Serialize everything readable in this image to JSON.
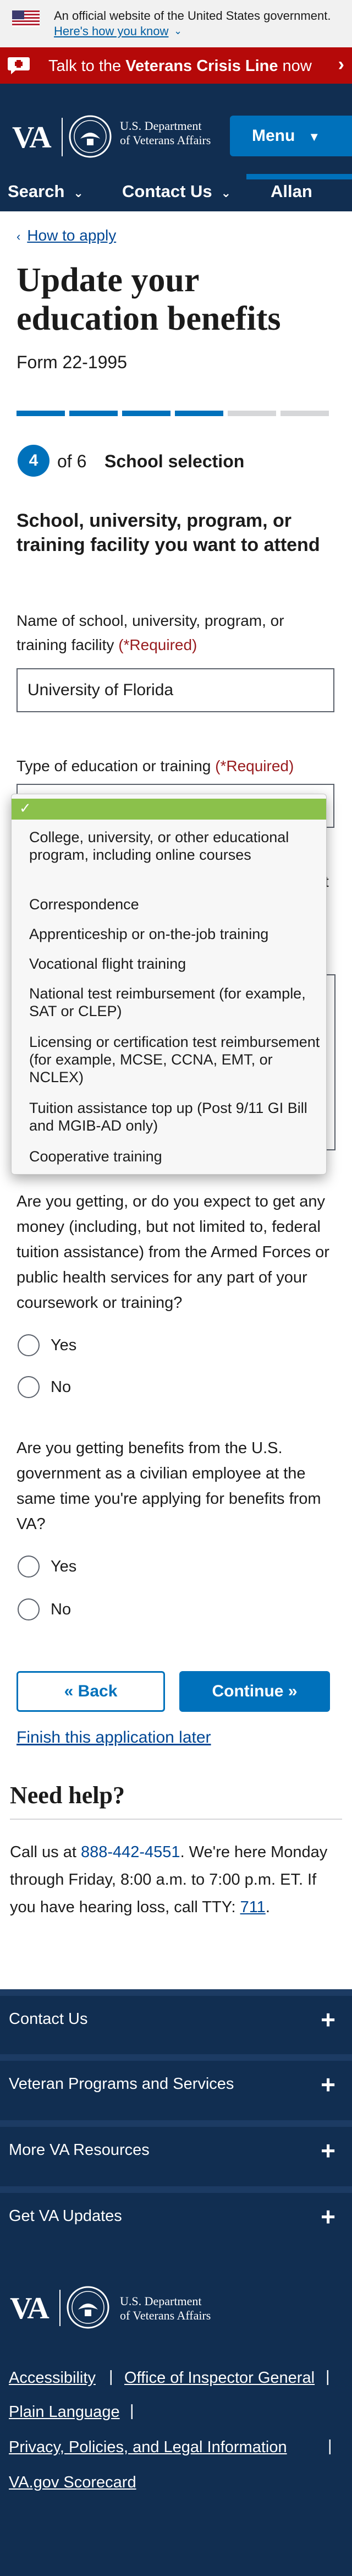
{
  "gov_banner": {
    "official_text": "An official website of the United States government.",
    "how_you_know": "Here's how you know"
  },
  "crisis_line": {
    "prefix": "Talk to the ",
    "strong": "Veterans Crisis Line",
    "suffix": " now"
  },
  "header": {
    "logo": "VA",
    "dept_line1": "U.S. Department",
    "dept_line2": "of Veterans Affairs",
    "menu_label": "Menu",
    "nav": [
      "Search",
      "Contact Us",
      "Allan"
    ]
  },
  "breadcrumb": {
    "label": "How to apply"
  },
  "page": {
    "title": "Update your education benefits",
    "form_number": "Form 22-1995"
  },
  "progress": {
    "current_step": "4",
    "total_label": "of 6",
    "step_name": "School selection",
    "completed_segments": 4,
    "total_segments": 6
  },
  "section": {
    "heading": "School, university, program, or training facility you want to attend"
  },
  "school_field": {
    "label": "Name of school, university, program, or training facility",
    "required": "(*Required)",
    "value": "University of Florida"
  },
  "education_type_field": {
    "label": "Type of education or training",
    "required": "(*Required)",
    "partial_text": "t",
    "options": [
      "College, university, or other educational program, including online courses",
      "Correspondence",
      "Apprenticeship or on-the-job training",
      "Vocational flight training",
      "National test reimbursement (for example, SAT or CLEP)",
      "Licensing or certification test reimbursement (for example, MCSE, CCNA, EMT, or NCLEX)",
      "Tuition assistance top up (Post 9/11 GI Bill and MGIB-AD only)",
      "Cooperative training"
    ]
  },
  "question_armed_forces": {
    "text": "Are you getting, or do you expect to get any money (including, but not limited to, federal tuition assistance) from the Armed Forces or public health services for any part of your coursework or training?",
    "yes": "Yes",
    "no": "No"
  },
  "question_civilian": {
    "text": "Are you getting benefits from the U.S. government as a civilian employee at the same time you're applying for benefits from VA?",
    "yes": "Yes",
    "no": "No"
  },
  "buttons": {
    "back": "Back",
    "continue": "Continue",
    "finish_later": "Finish this application later"
  },
  "help": {
    "heading": "Need help?",
    "text_before": "Call us at ",
    "phone": "888-442-4551",
    "text_after": ". We're here Monday through Friday, 8:00 a.m. to 7:00 p.m. ET. If you have hearing loss, call TTY: ",
    "tty": "711",
    "text_end": "."
  },
  "footer": {
    "accordions": [
      "Contact Us",
      "Veteran Programs and Services",
      "More VA Resources",
      "Get VA Updates"
    ],
    "logo": "VA",
    "dept_line1": "U.S. Department",
    "dept_line2": "of Veterans Affairs",
    "links": [
      "Accessibility",
      "Office of Inspector General",
      "Plain Language",
      "Privacy, Policies, and Legal Information",
      "VA.gov Scorecard"
    ]
  },
  "colors": {
    "primary": "#0071bb",
    "navy": "#112e51",
    "crisis_red": "#b50909",
    "required_red": "#981b1e",
    "selected_green": "#8bc14b"
  }
}
